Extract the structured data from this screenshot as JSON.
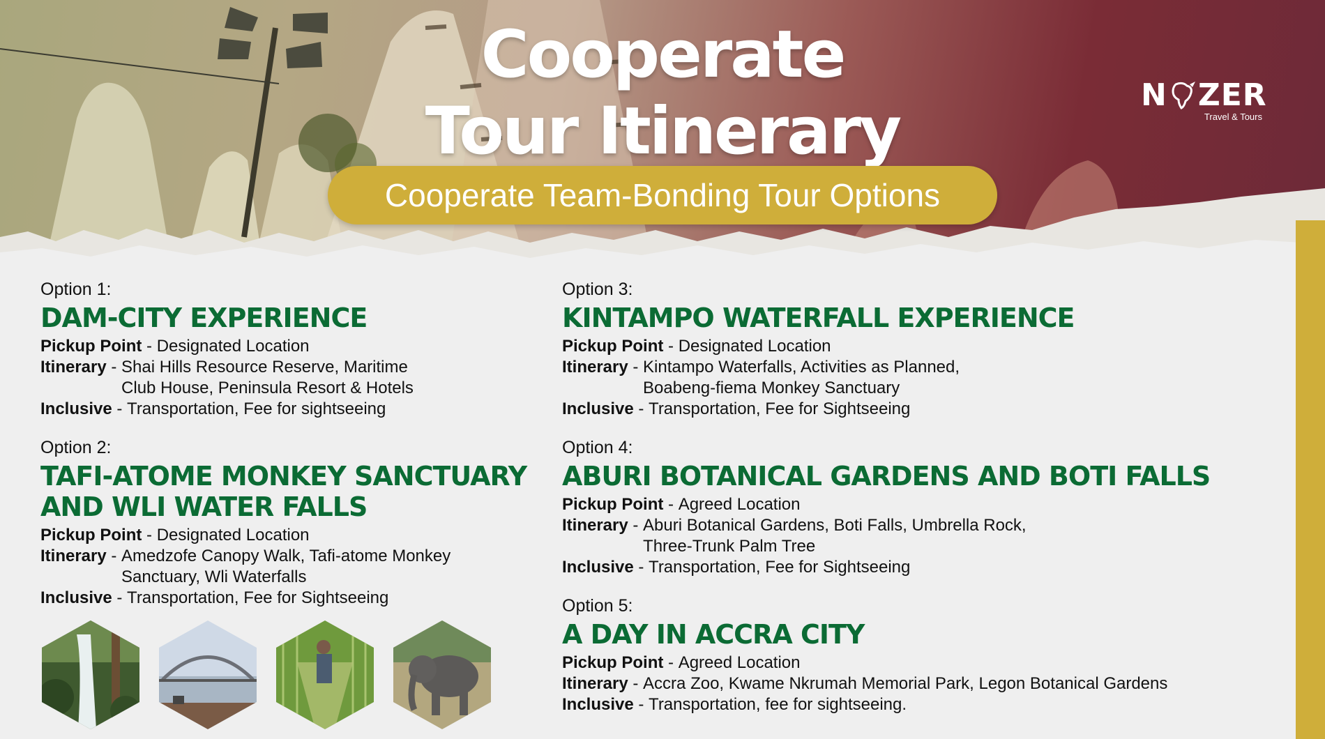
{
  "header": {
    "title_line1": "Cooperate",
    "title_line2": "Tour Itinerary",
    "subtitle": "Cooperate Team-Bonding Tour Options"
  },
  "logo": {
    "name_left": "N",
    "name_right": "ZER",
    "tagline": "Travel & Tours"
  },
  "options": [
    {
      "label": "Option 1:",
      "title": "DAM-CITY EXPERIENCE",
      "rows": [
        {
          "key": "Pickup Point",
          "value": "Designated Location"
        },
        {
          "key": "Itinerary",
          "value": "Shai Hills Resource Reserve, Maritime\nClub House, Peninsula Resort & Hotels"
        },
        {
          "key": "Inclusive",
          "value": "Transportation, Fee for sightseeing"
        }
      ]
    },
    {
      "label": "Option 2:",
      "title_line1": "TAFI-ATOME MONKEY SANCTUARY",
      "title_line2": "AND WLI WATER FALLS",
      "rows": [
        {
          "key": "Pickup Point",
          "value": "Designated Location"
        },
        {
          "key": "Itinerary",
          "value": "Amedzofe Canopy Walk, Tafi-atome Monkey\nSanctuary, Wli Waterfalls"
        },
        {
          "key": "Inclusive",
          "value": "Transportation, Fee for Sightseeing"
        }
      ]
    },
    {
      "label": "Option 3:",
      "title": "KINTAMPO WATERFALL EXPERIENCE",
      "rows": [
        {
          "key": "Pickup Point",
          "value": "Designated Location"
        },
        {
          "key": "Itinerary",
          "value": "Kintampo Waterfalls, Activities as Planned,\n Boabeng-fiema Monkey Sanctuary"
        },
        {
          "key": "Inclusive",
          "value": "Transportation, Fee for Sightseeing"
        }
      ]
    },
    {
      "label": "Option 4:",
      "title": "ABURI BOTANICAL GARDENS AND BOTI FALLS",
      "rows": [
        {
          "key": "Pickup Point",
          "value": "Agreed Location"
        },
        {
          "key": "Itinerary",
          "value": "Aburi Botanical Gardens, Boti Falls, Umbrella Rock,\nThree-Trunk Palm Tree"
        },
        {
          "key": "Inclusive",
          "value": "Transportation, Fee for Sightseeing"
        }
      ]
    },
    {
      "label": "Option 5:",
      "title": "A DAY IN ACCRA CITY",
      "rows": [
        {
          "key": "Pickup Point",
          "value": "Agreed Location"
        },
        {
          "key": "Itinerary",
          "value": "Accra Zoo, Kwame Nkrumah Memorial Park, Legon Botanical Gardens"
        },
        {
          "key": "Inclusive",
          "value": "Transportation, fee for sightseeing."
        }
      ]
    }
  ],
  "photos": [
    {
      "icon": "waterfall-photo"
    },
    {
      "icon": "bridge-photo"
    },
    {
      "icon": "canopy-walk-photo"
    },
    {
      "icon": "elephant-photo"
    }
  ],
  "colors": {
    "accent_gold": "#cfae3a",
    "title_green": "#0b6b34",
    "page_background": "#efefef"
  }
}
